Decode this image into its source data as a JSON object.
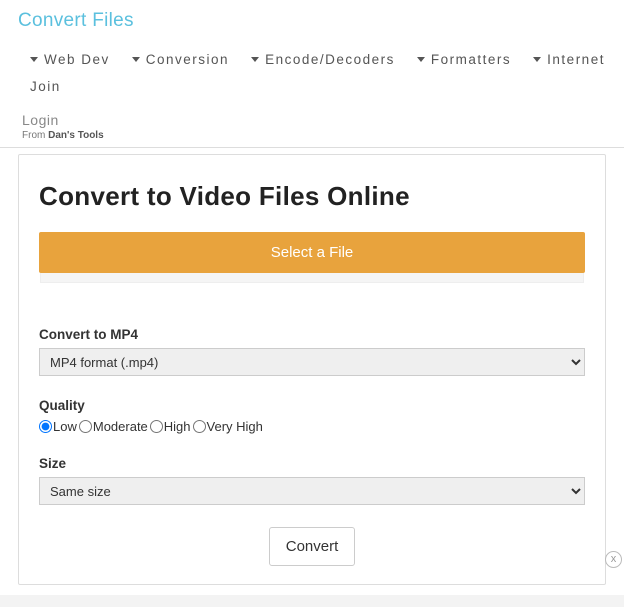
{
  "brand": "Convert Files",
  "nav": {
    "items": [
      {
        "label": "Web Dev",
        "caret": true
      },
      {
        "label": "Conversion",
        "caret": true
      },
      {
        "label": "Encode/Decoders",
        "caret": true
      },
      {
        "label": "Formatters",
        "caret": true
      },
      {
        "label": "Internet",
        "caret": true
      },
      {
        "label": "Join",
        "caret": false
      }
    ],
    "login": "Login",
    "from_prefix": "From ",
    "from_bold": "Dan's Tools"
  },
  "page": {
    "heading": "Convert to Video Files Online",
    "select_file": "Select a File",
    "format_label": "Convert to MP4",
    "format_selected": "MP4 format (.mp4)",
    "quality_label": "Quality",
    "quality_options": [
      "Low",
      "Moderate",
      "High",
      "Very High"
    ],
    "quality_selected": "Low",
    "size_label": "Size",
    "size_selected": "Same size",
    "convert_button": "Convert"
  },
  "ad_close": "x"
}
